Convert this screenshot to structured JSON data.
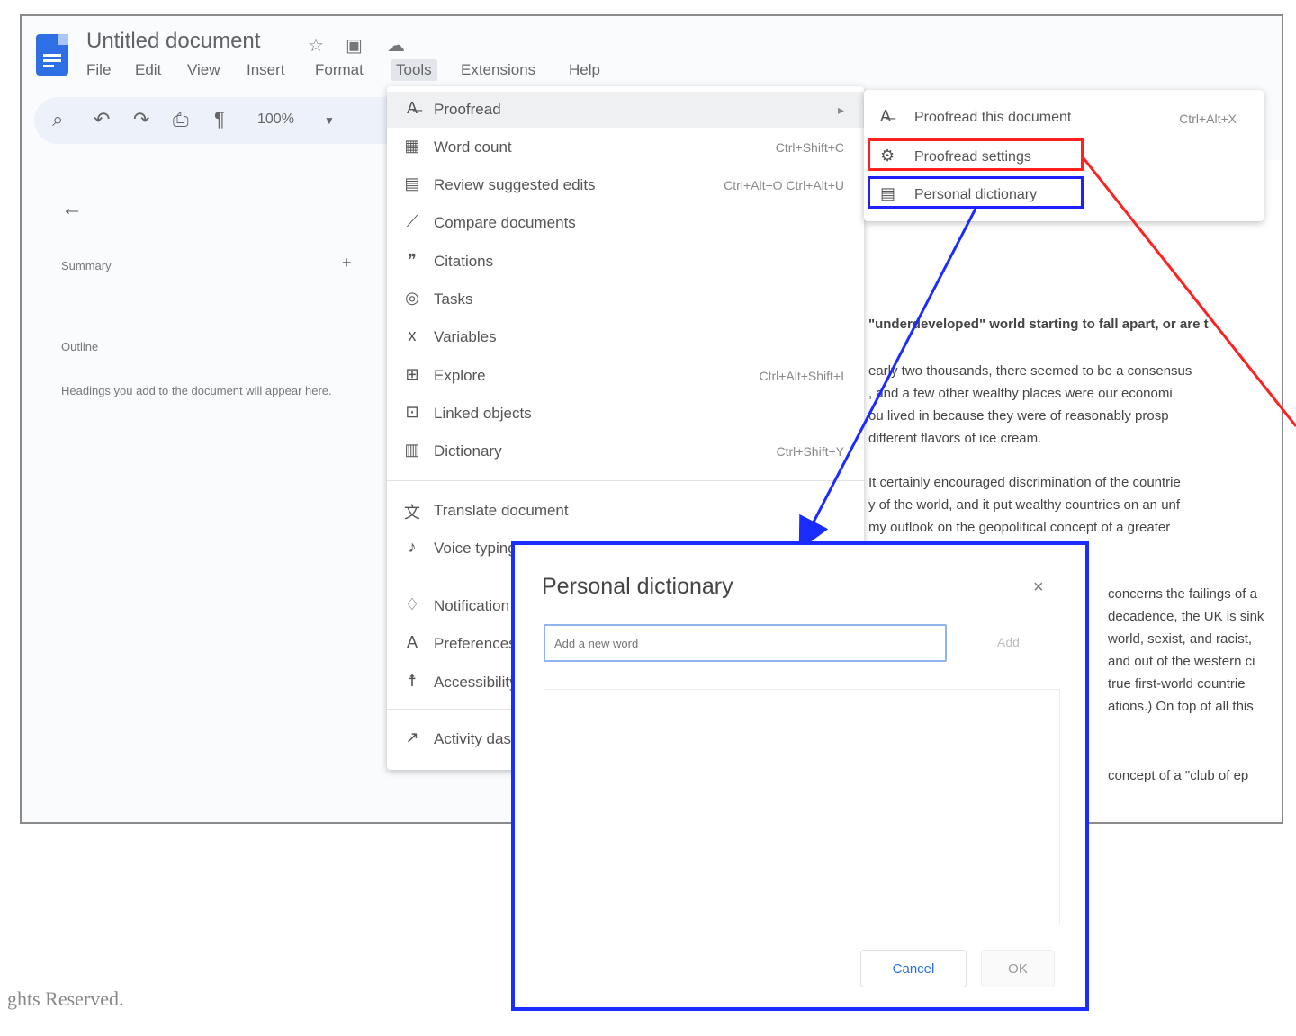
{
  "app": {
    "title": "Untitled document",
    "title_icons": [
      "star-icon",
      "folder-icon",
      "cloud-icon"
    ],
    "menus": [
      "File",
      "Edit",
      "View",
      "Insert",
      "Format",
      "Tools",
      "Extensions",
      "Help"
    ],
    "zoom": "100%"
  },
  "outline": {
    "summary_label": "Summary",
    "outline_label": "Outline",
    "hint": "Headings you add to the document will appear here."
  },
  "document": {
    "paragraphs": [
      [
        "\"underdeveloped\" world starting to fall apart, or are t"
      ],
      [
        "early two thousands, there seemed to be a consensus",
        ", and a few other wealthy places were our economi",
        "ou lived in because they were of reasonably prosp",
        "different flavors of ice cream."
      ],
      [
        "It certainly encouraged discrimination of the countrie",
        "y of the world, and it put wealthy countries on an unf",
        "my outlook on the geopolitical concept of a greater"
      ],
      [
        "concerns the failings of a",
        "decadence, the UK is sink",
        "world, sexist, and racist,",
        "and out of the western ci",
        "true first-world countrie",
        "ations.) On top of all this"
      ],
      [
        "concept of a \"club of ep"
      ]
    ]
  },
  "tools_menu": {
    "items": [
      {
        "icon": "proofread-icon",
        "label": "Proofread",
        "shortcut": "▸"
      },
      {
        "icon": "word-count-icon",
        "label": "Word count",
        "shortcut": "Ctrl+Shift+C"
      },
      {
        "icon": "review-edits-icon",
        "label": "Review suggested edits",
        "shortcut": "Ctrl+Alt+O Ctrl+Alt+U"
      },
      {
        "icon": "compare-icon",
        "label": "Compare documents",
        "shortcut": ""
      },
      {
        "icon": "citations-icon",
        "label": "Citations",
        "shortcut": ""
      },
      {
        "icon": "tasks-icon",
        "label": "Tasks",
        "shortcut": ""
      },
      {
        "icon": "variables-icon",
        "label": "Variables",
        "shortcut": ""
      },
      {
        "icon": "explore-icon",
        "label": "Explore",
        "shortcut": "Ctrl+Alt+Shift+I"
      },
      {
        "icon": "linked-objects-icon",
        "label": "Linked objects",
        "shortcut": ""
      },
      {
        "icon": "dictionary-icon",
        "label": "Dictionary",
        "shortcut": "Ctrl+Shift+Y"
      },
      {
        "icon": "translate-icon",
        "label": "Translate document",
        "shortcut": ""
      },
      {
        "icon": "voice-typing-icon",
        "label": "Voice typing",
        "shortcut": ""
      },
      {
        "icon": "notification-icon",
        "label": "Notification settings",
        "shortcut": ""
      },
      {
        "icon": "preferences-icon",
        "label": "Preferences",
        "shortcut": ""
      },
      {
        "icon": "accessibility-icon",
        "label": "Accessibility",
        "shortcut": ""
      },
      {
        "icon": "activity-icon",
        "label": "Activity dashboard",
        "shortcut": ""
      }
    ]
  },
  "submenu": {
    "items": [
      {
        "icon": "proofread-doc-icon",
        "label": "Proofread this document",
        "shortcut": "Ctrl+Alt+X"
      },
      {
        "icon": "settings-icon",
        "label": "Proofread settings",
        "shortcut": ""
      },
      {
        "icon": "book-icon",
        "label": "Personal dictionary",
        "shortcut": ""
      }
    ]
  },
  "dialog": {
    "title": "Personal dictionary",
    "close": "×",
    "input_placeholder": "Add a new word",
    "add_label": "Add",
    "cancel_label": "Cancel",
    "ok_label": "OK"
  },
  "footer": {
    "text": "ghts Reserved."
  },
  "colors": {
    "highlight_red": "#ff2020",
    "highlight_blue": "#1a2cff",
    "doc_blue": "#2f6fe6"
  }
}
